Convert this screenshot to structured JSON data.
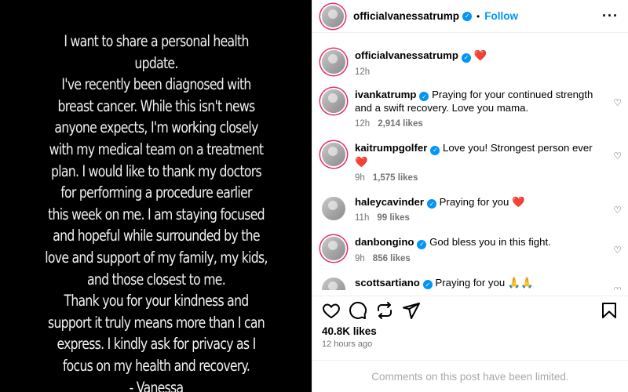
{
  "post": {
    "lines": [
      "I want to share a personal health",
      "update.",
      "I've recently been diagnosed with",
      "breast cancer. While this isn't news",
      "anyone expects, I'm working closely",
      "with my medical team on a treatment",
      "plan. I would like to thank my doctors",
      "for performing a procedure earlier",
      "this week on me. I am staying focused",
      "and hopeful while surrounded by the",
      "love and support of my family, my kids,",
      "and those closest to me.",
      "Thank you for your kindness and",
      "support it truly means more than I can",
      "express. I kindly ask for privacy as I",
      "focus on my health and recovery.",
      "- Vanessa"
    ]
  },
  "header": {
    "username": "officialvanessatrump",
    "separator": "•",
    "follow_label": "Follow",
    "more_icon": "more-horizontal-icon"
  },
  "caption": {
    "username": "officialvanessatrump",
    "text": "❤️",
    "time": "12h"
  },
  "comments": [
    {
      "username": "ivankatrump",
      "text": "Praying for your continued strength and a swift recovery. Love you mama.",
      "time": "12h",
      "likes": "2,914 likes"
    },
    {
      "username": "kaitrumpgolfer",
      "text": "Love you! Strongest person ever ❤️",
      "time": "9h",
      "likes": "1,575 likes"
    },
    {
      "username": "haleycavinder",
      "text": "Praying for you ❤️",
      "time": "11h",
      "likes": "99 likes"
    },
    {
      "username": "danbongino",
      "text": "God bless you in this fight.",
      "time": "9h",
      "likes": "856 likes"
    },
    {
      "username": "scottsartiano",
      "text": "Praying for you 🙏🙏",
      "time": "",
      "likes": ""
    }
  ],
  "footer": {
    "likes": "40.8K likes",
    "time_ago": "12 hours ago",
    "limited_text": "Comments on this post have been limited."
  },
  "colors": {
    "link": "#0095f6",
    "muted": "#737373",
    "verified": "#0095f6"
  }
}
